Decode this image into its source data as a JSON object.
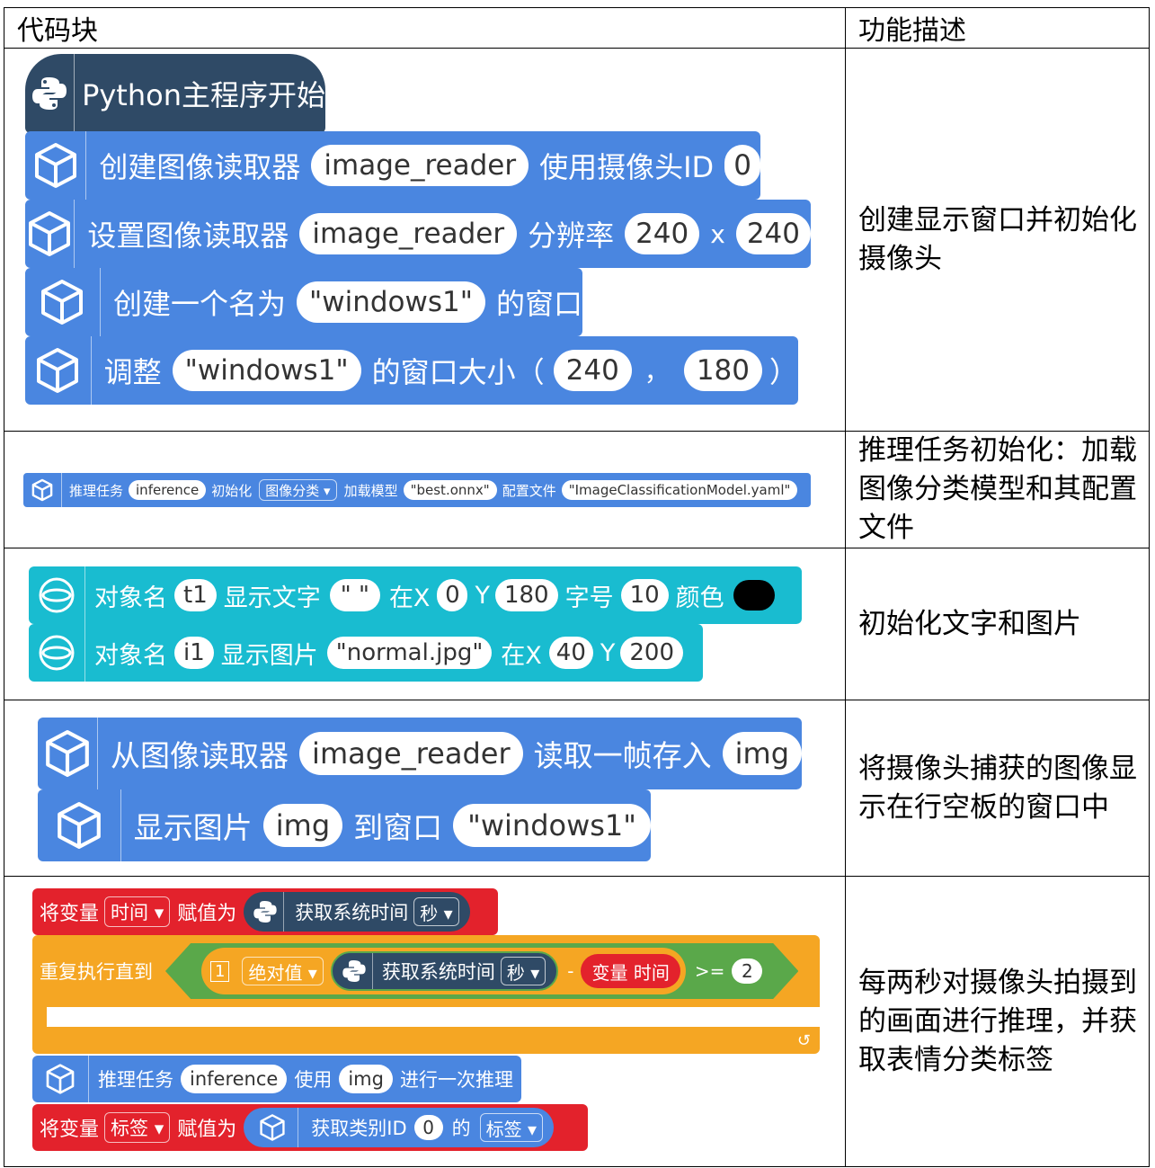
{
  "header": {
    "col1": "代码块",
    "col2": "功能描述"
  },
  "rows": [
    {
      "desc": "创建显示窗口并初始化摄像头",
      "hat": "Python主程序开始",
      "b1": {
        "t1": "创建图像读取器",
        "v1": "image_reader",
        "t2": "使用摄像头ID",
        "v2": "0"
      },
      "b2": {
        "t1": "设置图像读取器",
        "v1": "image_reader",
        "t2": "分辨率",
        "v2": "240",
        "x": "x",
        "v3": "240"
      },
      "b3": {
        "t1": "创建一个名为",
        "v1": "\"windows1\"",
        "t2": "的窗口"
      },
      "b4": {
        "t1": "调整",
        "v1": "\"windows1\"",
        "t2": "的窗口大小（",
        "v2": "240",
        "comma": "，",
        "v3": "180",
        "t3": "）"
      }
    },
    {
      "desc": "推理任务初始化：加载图像分类模型和其配置文件",
      "b1": {
        "t1": "推理任务",
        "v1": "inference",
        "t2": "初始化",
        "dd": "图像分类 ▾",
        "t3": "加载模型",
        "v2": "\"best.onnx\"",
        "t4": "配置文件",
        "v3": "\"ImageClassificationModel.yaml\""
      }
    },
    {
      "desc": "初始化文字和图片",
      "b1": {
        "t1": "对象名",
        "v1": "t1",
        "t2": "显示文字",
        "v2": "\" \"",
        "t3": "在X",
        "v3": "0",
        "t4": "Y",
        "v4": "180",
        "t5": "字号",
        "v5": "10",
        "t6": "颜色"
      },
      "b2": {
        "t1": "对象名",
        "v1": "i1",
        "t2": "显示图片",
        "v2": "\"normal.jpg\"",
        "t3": "在X",
        "v3": "40",
        "t4": "Y",
        "v4": "200"
      },
      "color_swatch": "#000000"
    },
    {
      "desc": "将摄像头捕获的图像显示在行空板的窗口中",
      "b1": {
        "t1": "从图像读取器",
        "v1": "image_reader",
        "t2": "读取一帧存入",
        "v2": "img"
      },
      "b2": {
        "t1": "显示图片",
        "v1": "img",
        "t2": "到窗口",
        "v2": "\"windows1\""
      }
    },
    {
      "desc": "每两秒对摄像头拍摄到的画面进行推理，并获取表情分类标签",
      "b1": {
        "t1": "将变量",
        "dd1": "时间 ▾",
        "t2": "赋值为",
        "t3": "获取系统时间",
        "dd2": "秒 ▾"
      },
      "b2": {
        "t1": "重复执行直到",
        "num": "1",
        "dd1": "绝对值 ▾",
        "t2": "获取系统时间",
        "dd2": "秒 ▾",
        "minus": "-",
        "var": "变量 时间",
        "op": ">=",
        "v1": "2"
      },
      "b3": {
        "t1": "推理任务",
        "v1": "inference",
        "t2": "使用",
        "v2": "img",
        "t3": "进行一次推理"
      },
      "b4": {
        "t1": "将变量",
        "dd1": "标签 ▾",
        "t2": "赋值为",
        "t3": "获取类别ID",
        "v1": "0",
        "t4": "的",
        "dd2": "标签 ▾"
      }
    }
  ]
}
